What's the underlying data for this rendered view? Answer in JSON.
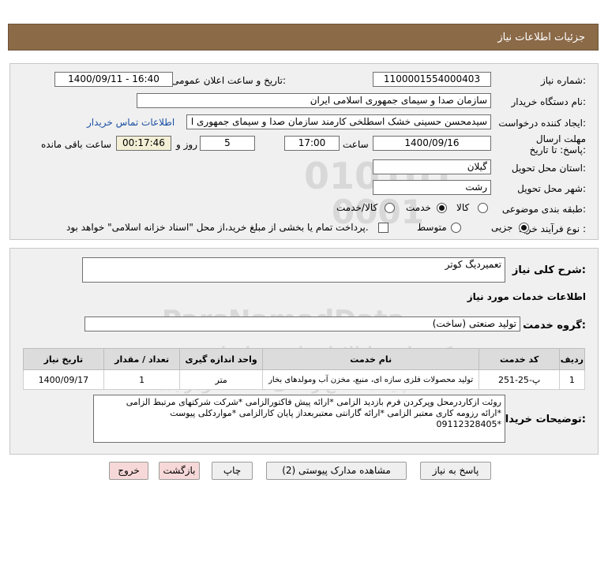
{
  "header": {
    "title": "جزئیات اطلاعات نیاز"
  },
  "form": {
    "need_number_label": "شماره نیاز:",
    "need_number": "1100001554000403",
    "announce_label": "تاریخ و ساعت اعلان عمومی:",
    "announce_value": "1400/09/11 - 16:40",
    "buyer_org_label": "نام دستگاه خریدار:",
    "buyer_org": "سازمان صدا و سیمای جمهوری اسلامی ایران",
    "requester_label": "ایجاد کننده درخواست:",
    "requester": "سیدمحسن حسینی خشک اسطلخی کارمند سازمان صدا و سیمای جمهوری ا",
    "contact_link": "اطلاعات تماس خریدار",
    "deadline_label": "مهلت ارسال پاسخ: تا تاریخ:",
    "deadline_date": "1400/09/16",
    "time_label": "ساعت",
    "deadline_time": "17:00",
    "days_value": "5",
    "days_label": "روز و",
    "remaining_value": "00:17:46",
    "remaining_label": "ساعت باقی مانده",
    "province_label": "استان محل تحویل:",
    "province": "گیلان",
    "city_label": "شهر محل تحویل:",
    "city": "رشت",
    "category_label": "طبقه بندی موضوعی:",
    "category_options": [
      "کالا",
      "خدمت",
      "کالا/خدمت"
    ],
    "category_selected": "خدمت",
    "process_label": "نوع فرآیند خرید :",
    "process_options": [
      "جزیی",
      "متوسط"
    ],
    "process_selected": "جزیی",
    "treasury_note": "پرداخت تمام یا بخشی از مبلغ خرید،از محل \"اسناد خزانه اسلامی\" خواهد بود."
  },
  "description": {
    "label": "شرح کلی نیاز:",
    "value": "تعمیردیگ کوتر",
    "services_heading": "اطلاعات خدمات مورد نیاز",
    "service_group_label": "گروه خدمت:",
    "service_group": "تولید صنعتی (ساخت)"
  },
  "table": {
    "headers": [
      "ردیف",
      "کد خدمت",
      "نام خدمت",
      "واحد اندازه گیری",
      "تعداد / مقدار",
      "تاریخ نیاز"
    ],
    "rows": [
      [
        "1",
        "پ-25-251",
        "تولید محصولات فلزی سازه ای، منبع، مخزن آب ومولدهای بخار",
        "متر",
        "1",
        "1400/09/17"
      ]
    ]
  },
  "buyer_notes": {
    "label": "توضیحات خریدار:",
    "lines": [
      "روئت ازکاردرمحل وپرکردن فرم بازدید الزامی *ارائه پیش فاکتورالزامی *شرکت شرکتهای مرتبط الزامی",
      "*ارائه رزومه کاری معتبر الزامی *ارائه گارانتی معتبربعداز پایان کارالزامی *مواردکلی پیوست",
      "*09112328405"
    ]
  },
  "buttons": {
    "reply": "پاسخ به نیاز",
    "attachments": "مشاهده مدارک پیوستی (2)",
    "print": "چاپ",
    "back": "بازگشت",
    "exit": "خروج"
  },
  "watermark": {
    "digits1": "010101",
    "digits2": "0001",
    "brand": "ParsNamadData",
    "sub1": "مرکز فراوری اطلاعات پارس نماد داده",
    "sub2": "پایگاه اطلاع رسانی مناقصه ومزایده"
  }
}
